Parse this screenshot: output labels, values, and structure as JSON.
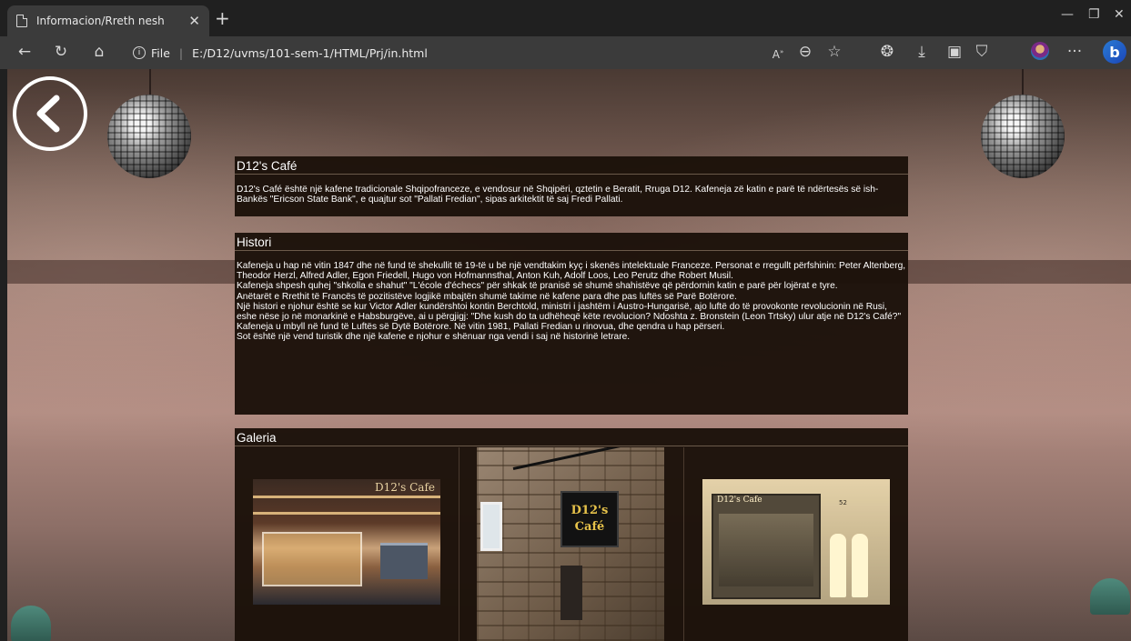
{
  "browser": {
    "tab_title": "Informacion/Rreth nesh",
    "address_label": "File",
    "address_url": "E:/D12/uvms/101-sem-1/HTML/Prj/in.html"
  },
  "page": {
    "sections": [
      {
        "title": "D12's Café",
        "paragraphs": [
          "D12's Café është një kafene tradicionale Shqipofranceze, e vendosur në Shqipëri, qztetin e Beratit, Rruga D12. Kafeneja zë katin e parë të ndërtesës së ish-Bankës \"Ericson State Bank\", e quajtur sot \"Pallati Fredian\", sipas arkitektit të saj Fredi Pallati."
        ]
      },
      {
        "title": "Histori",
        "paragraphs": [
          "Kafeneja u hap në vitin 1847 dhe në fund të shekullit të 19-të u bë një vendtakim kyç i skenës intelektuale Franceze. Personat e rregullt përfshinin: Peter Altenberg, Theodor Herzl, Alfred Adler, Egon Friedell, Hugo von Hofmannsthal, Anton Kuh, Adolf Loos, Leo Perutz dhe Robert Musil.",
          "Kafeneja shpesh quhej \"shkolla e shahut\" \"L'école d'échecs\" për shkak të pranisë së shumë shahistëve që përdornin katin e parë për lojërat e tyre.",
          "Anëtarët e Rrethit të Francës të pozitistëve logjikë mbajtën shumë takime në kafene para dhe pas luftës së Parë Botërore.",
          "Një histori e njohur është se kur Victor Adler kundërshtoi kontin Berchtold, ministri i jashtëm i Austro-Hungarisë, ajo luftë do të provokonte revolucionin në Rusi, eshe nëse jo në monarkinë e Habsburgëve, ai u përgjigj: \"Dhe kush do ta udhëheqë këte revolucion? Ndoshta z. Bronstein (Leon Trtsky) ulur atje në D12's Café?\"",
          "Kafeneja u mbyll në fund të Luftës së Dytë Botërore. Në vitin 1981, Pallati Fredian u rinovua, dhe qendra u hap përseri.",
          "Sot është një vend turistik dhe një kafene e njohur e shënuar nga vendi i saj në historinë letrare."
        ]
      }
    ],
    "gallery_title": "Galeria",
    "gallery": [
      {
        "sign_text": "D12's Cafe"
      },
      {
        "sign_text_line1": "D12's",
        "sign_text_line2": "Café"
      },
      {
        "sign_text": "D12's Cafe",
        "number": "52"
      }
    ]
  }
}
